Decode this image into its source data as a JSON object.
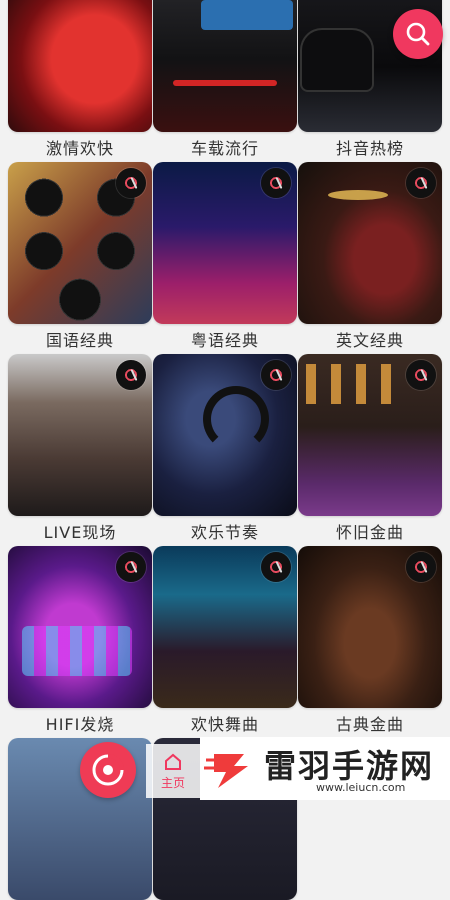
{
  "colors": {
    "accent": "#f0385f",
    "background": "#f2f2f2",
    "label_text": "#333333"
  },
  "icons": {
    "search": "search-icon",
    "disc": "vinyl-disc-icon",
    "home": "home-icon",
    "badge": "vinyl-record-icon"
  },
  "categories": [
    {
      "label": "激情欢快",
      "badge": false
    },
    {
      "label": "车载流行",
      "badge": false
    },
    {
      "label": "抖音热榜",
      "badge": false
    },
    {
      "label": "国语经典",
      "badge": true
    },
    {
      "label": "粤语经典",
      "badge": true
    },
    {
      "label": "英文经典",
      "badge": true
    },
    {
      "label": "LIVE现场",
      "badge": true
    },
    {
      "label": "欢乐节奏",
      "badge": true
    },
    {
      "label": "怀旧金曲",
      "badge": true
    },
    {
      "label": "HIFI发烧",
      "badge": true
    },
    {
      "label": "欢快舞曲",
      "badge": true
    },
    {
      "label": "古典金曲",
      "badge": true
    }
  ],
  "nav": {
    "home_label": "主页"
  },
  "watermark": {
    "brand": "雷羽手游网",
    "url": "www.leiucn.com"
  }
}
